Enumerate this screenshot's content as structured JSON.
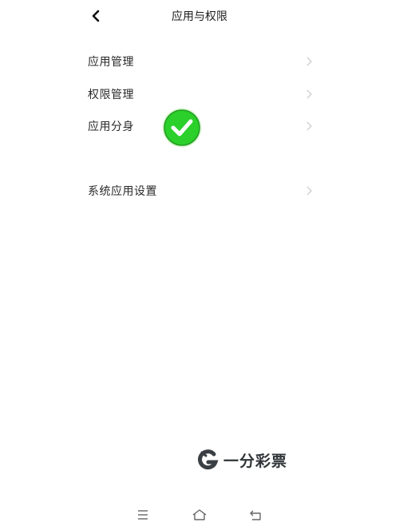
{
  "header": {
    "title": "应用与权限",
    "back_icon": "chevron-left-icon"
  },
  "list": {
    "items": [
      {
        "label": "应用管理"
      },
      {
        "label": "权限管理"
      },
      {
        "label": "应用分身"
      },
      {
        "label": "系统应用设置"
      }
    ],
    "chevron_icon": "chevron-right-icon"
  },
  "overlay": {
    "check_icon": "green-check-icon",
    "check_color": "#2bd02b"
  },
  "watermark": {
    "logo_icon": "g-logo-icon",
    "text": "一分彩票"
  },
  "navbar": {
    "menu_icon": "menu-icon",
    "home_icon": "home-icon",
    "back_icon": "back-icon"
  }
}
